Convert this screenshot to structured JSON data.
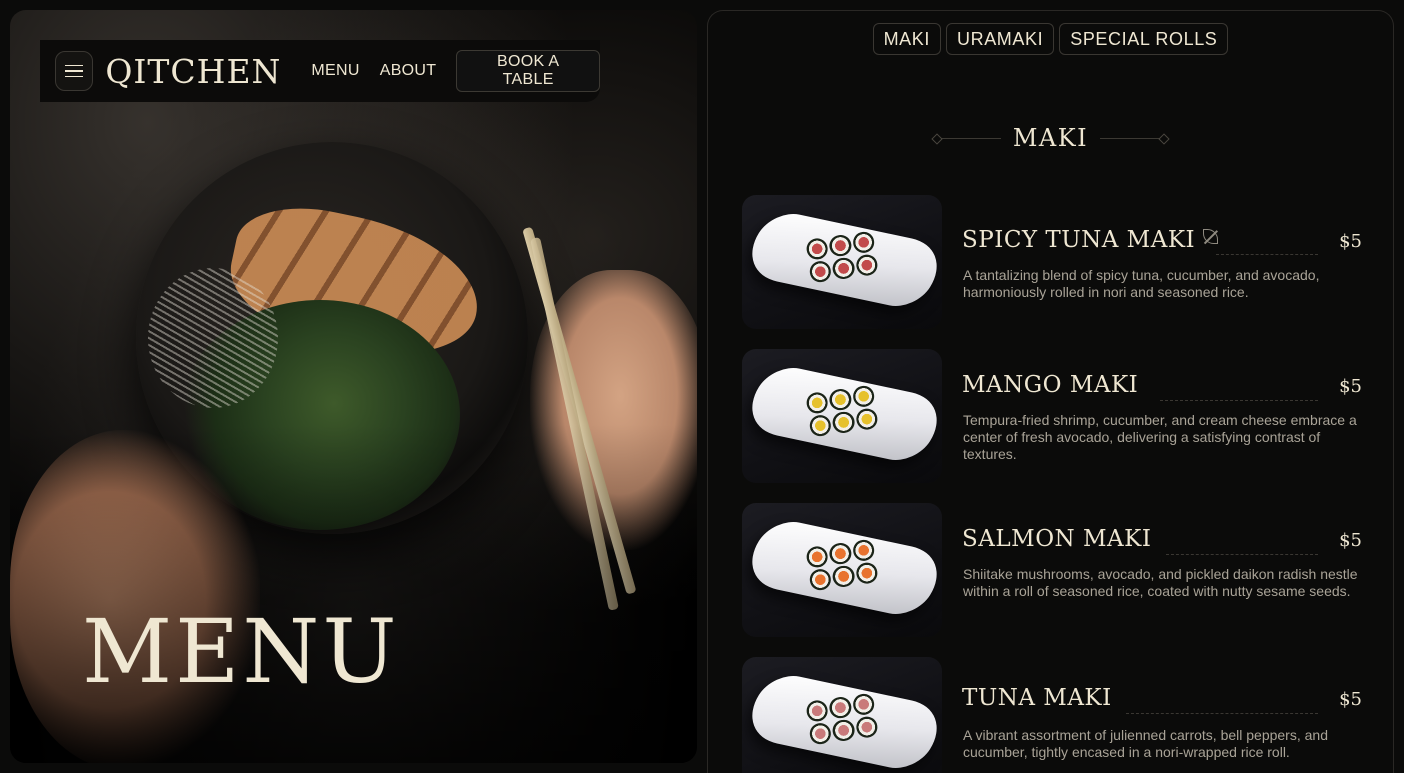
{
  "nav": {
    "logo": "QITCHEN",
    "links": [
      "MENU",
      "ABOUT"
    ],
    "cta": "BOOK A TABLE"
  },
  "hero": {
    "title": "MENU"
  },
  "menu": {
    "tabs": [
      "MAKI",
      "URAMAKI",
      "SPECIAL ROLLS"
    ],
    "section_title": "MAKI",
    "items": [
      {
        "name": "SPICY TUNA MAKI",
        "price": "$5",
        "vegetarian_icon": "leaf-icon",
        "roll_color": "#c24b4b",
        "description": "A tantalizing blend of spicy tuna, cucumber, and avocado, harmoniously rolled in nori and seasoned rice."
      },
      {
        "name": "MANGO MAKI",
        "price": "$5",
        "roll_color": "#e6c12c",
        "description": "Tempura-fried shrimp, cucumber, and cream cheese embrace a center of fresh avocado, delivering a satisfying contrast of textures."
      },
      {
        "name": "SALMON MAKI",
        "price": "$5",
        "roll_color": "#e8732e",
        "description": "Shiitake mushrooms, avocado, and pickled daikon radish nestle within a roll of seasoned rice, coated with nutty sesame seeds."
      },
      {
        "name": "TUNA MAKI",
        "price": "$5",
        "roll_color": "#c97a7a",
        "description": "A vibrant assortment of julienned carrots, bell peppers, and cucumber, tightly encased in a nori-wrapped rice roll."
      }
    ]
  },
  "colors": {
    "background": "#0b0b0a",
    "text": "#efe7d2",
    "muted": "#a9a397",
    "border": "#3a3732"
  }
}
